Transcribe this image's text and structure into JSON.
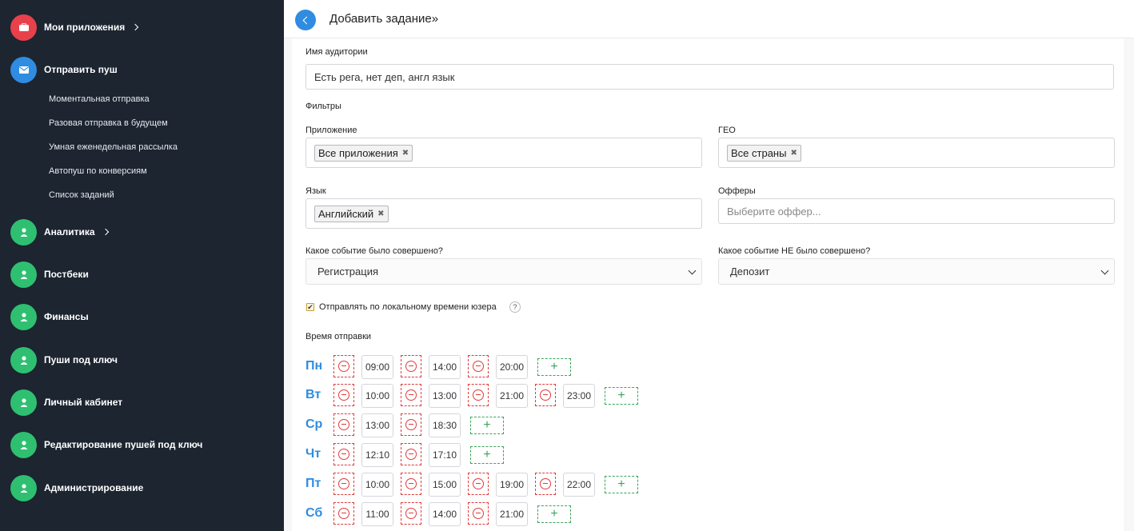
{
  "colors": {
    "sidebar_bg": "#1c2530",
    "accent": "#2f8ce0",
    "nav_green": "#2fbf71",
    "nav_red": "#e8414b",
    "remove": "#e23a3a",
    "add": "#3aa55b"
  },
  "sidebar": {
    "items": [
      {
        "label": "Мои приложения",
        "icon": "briefcase-icon",
        "color": "#e8414b",
        "chevron": true
      },
      {
        "label": "Отправить пуш",
        "icon": "envelope-icon",
        "color": "#2f8ce0",
        "chevron": false
      },
      {
        "label": "Аналитика",
        "icon": "user-icon",
        "color": "#2fbf71",
        "chevron": true
      },
      {
        "label": "Постбеки",
        "icon": "user-icon",
        "color": "#2fbf71",
        "chevron": false
      },
      {
        "label": "Финансы",
        "icon": "user-icon",
        "color": "#2fbf71",
        "chevron": false
      },
      {
        "label": "Пуши под ключ",
        "icon": "user-icon",
        "color": "#2fbf71",
        "chevron": false
      },
      {
        "label": "Личный кабинет",
        "icon": "user-icon",
        "color": "#2fbf71",
        "chevron": false
      },
      {
        "label": "Редактирование пушей под ключ",
        "icon": "user-icon",
        "color": "#2fbf71",
        "chevron": false
      },
      {
        "label": "Администрирование",
        "icon": "user-icon",
        "color": "#2fbf71",
        "chevron": false
      }
    ],
    "subitems": [
      "Моментальная отправка",
      "Разовая отправка в будущем",
      "Умная еженедельная рассылка",
      "Автопуш по конверсиям",
      "Список заданий"
    ]
  },
  "header": {
    "title": "Добавить задание»"
  },
  "form": {
    "audience_label": "Имя аудитории",
    "audience_value": "Есть рега, нет деп, англ язык",
    "filters_label": "Фильтры",
    "app_label": "Приложение",
    "app_tag": "Все приложения",
    "geo_label": "ГЕО",
    "geo_tag": "Все страны",
    "lang_label": "Язык",
    "lang_tag": "Английский",
    "offers_label": "Офферы",
    "offers_placeholder": "Выберите оффер...",
    "event_done_label": "Какое событие было совершено?",
    "event_done_value": "Регистрация",
    "event_not_done_label": "Какое событие НЕ было совершено?",
    "event_not_done_value": "Депозит",
    "local_time_label": "Отправлять по локальному времени юзера",
    "local_time_checked": true,
    "help_glyph": "?",
    "send_time_label": "Время отправки",
    "tag_remove_glyph": "✖",
    "add_glyph": "+"
  },
  "schedule": [
    {
      "day": "Пн",
      "times": [
        "09:00",
        "14:00",
        "20:00"
      ]
    },
    {
      "day": "Вт",
      "times": [
        "10:00",
        "13:00",
        "21:00",
        "23:00"
      ]
    },
    {
      "day": "Ср",
      "times": [
        "13:00",
        "18:30"
      ]
    },
    {
      "day": "Чт",
      "times": [
        "12:10",
        "17:10"
      ]
    },
    {
      "day": "Пт",
      "times": [
        "10:00",
        "15:00",
        "19:00",
        "22:00"
      ]
    },
    {
      "day": "Сб",
      "times": [
        "11:00",
        "14:00",
        "21:00"
      ]
    }
  ]
}
